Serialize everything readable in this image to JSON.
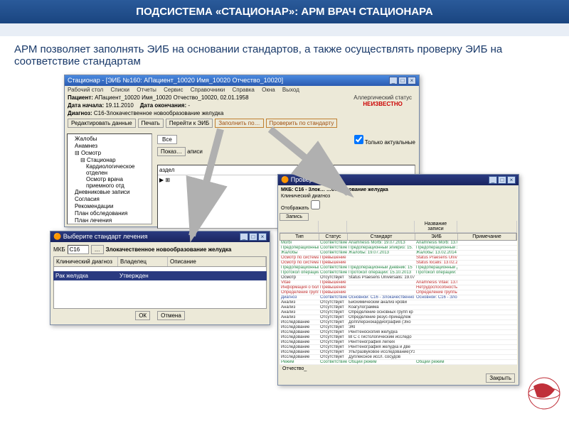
{
  "header": "ПОДСИСТЕМА «СТАЦИОНАР»: АРМ ВРАЧ СТАЦИОНАРА",
  "intro": "АРМ позволяет заполнять ЭИБ на основании стандартов, а также осуществлять проверку ЭИБ на соответствие стандартам",
  "main": {
    "title": "Стационар - [ЭИБ №160: АПациент_10020 Имя_10020 Отчество_10020]",
    "menu": [
      "Рабочий стол",
      "Списки",
      "Отчеты",
      "Сервис",
      "Справочники",
      "Справка",
      "Окна",
      "Выход"
    ],
    "patient_lbl": "Пациент:",
    "patient": "АПациент_10020 Имя_10020 Отчество_10020, 02.01.1958",
    "date_start_lbl": "Дата начала:",
    "date_start": "19.11.2010",
    "date_end_lbl": "Дата окончания:",
    "date_end": "-",
    "diag_lbl": "Диагноз:",
    "diag": "C16-Злокачественное новообразование желудка",
    "allergy_lbl": "Аллергический статус",
    "allergy_val": "НЕИЗВЕСТНО",
    "buttons": {
      "edit": "Редактировать данные",
      "print": "Печать",
      "goto": "Перейти к ЭИБ",
      "fill": "Заполнить по…",
      "check": "Проверить по стандарту"
    },
    "tab_all": "Все",
    "only_actual": "Только актуальные",
    "show_btn": "Показ…",
    "list_lbl": "аписи",
    "razdel": "аздел",
    "tree": [
      "Жалобы",
      "Анамнез",
      "Осмотр",
      "Стационар",
      "Кардиологическое отделен",
      "Осмотр врача приемного отд",
      "Дневниковые записи",
      "Согласия",
      "Рекомендации",
      "План обследования",
      "План лечения"
    ]
  },
  "dlg1": {
    "title": "Выберите стандарт лечения",
    "mkb_lbl": "МКБ",
    "mkb_val": "C16",
    "diag": "Злокачественное новообразование желудка",
    "cols": [
      "Клинический диагноз",
      "Владелец",
      "Описание"
    ],
    "row": [
      "Рак желудка",
      "Утвержден",
      ""
    ],
    "ok": "ОК",
    "cancel": "Отмена"
  },
  "win2": {
    "title": "Проверка по…",
    "mkb_line": "МКБ: C16 - Злок…                  …ообразование желудка",
    "diag2": "Клинический диагноз",
    "filter": "Отображать",
    "tab1": "Запись",
    "tab2": "Название записи",
    "cols": [
      "Тип",
      "Статус",
      "Стандарт",
      "ЭИБ",
      "Примечание"
    ],
    "rows": [
      {
        "c": "c-green",
        "v": [
          "Morbi",
          "Соответствие",
          "Anamnesis Morbi: 19.07.2013",
          "Anamnesis Morb: 13.02.2014",
          ""
        ]
      },
      {
        "c": "c-green",
        "v": [
          "Предоперационный д",
          "Соответствие",
          "Предоперационный эпикриз: 15.",
          "Предоперационный эпикриз: 13.02",
          ""
        ]
      },
      {
        "c": "c-green",
        "v": [
          "Жалобы",
          "Соответствие",
          "Жалобы: 19.07.2013",
          "Жалобы: 13.02.2014",
          ""
        ]
      },
      {
        "c": "c-red",
        "v": [
          "Осмотр по системам о",
          "Превышение",
          "",
          "Status Praesens Universalis: 13.02.201",
          ""
        ]
      },
      {
        "c": "c-red",
        "v": [
          "Осмотр по системам о",
          "Превышение",
          "",
          "Status localis: 13.02.2014",
          ""
        ]
      },
      {
        "c": "c-green",
        "v": [
          "Предоперационный д",
          "Соответствие",
          "Предоперационный дневник: 15",
          "Предоперационный дневник: 18.02.",
          ""
        ]
      },
      {
        "c": "c-green",
        "v": [
          "Протокол операции",
          "Соответствие",
          "Протокол операции: 15.10.2013",
          "Протокол операции: 13.02.2014",
          ""
        ]
      },
      {
        "c": "c-black",
        "v": [
          "Осмотр",
          "Отсутствует",
          "Status Praesens Universalis: 19.07",
          "",
          ""
        ]
      },
      {
        "c": "c-red",
        "v": [
          "Vitae",
          "Превышение",
          "",
          "Anamnesis Vitae: 13.02.2014",
          ""
        ]
      },
      {
        "c": "c-red",
        "v": [
          "Информация о больни",
          "Превышение",
          "",
          "Нетрудоспособность: 13.02.2014",
          ""
        ]
      },
      {
        "c": "c-red",
        "v": [
          "Определение группы",
          "Превышение",
          "",
          "Определение группы крови: 13.02.2014",
          ""
        ]
      },
      {
        "c": "c-blue",
        "v": [
          "Диагноз",
          "Соответствие",
          "Основной: C16 - Злокачественно",
          "Основной: C16 - Злокачественное но",
          ""
        ]
      },
      {
        "c": "c-black",
        "v": [
          "Анализ",
          "Отсутствует",
          "Биохимический анализ крови",
          "",
          ""
        ]
      },
      {
        "c": "c-black",
        "v": [
          "Анализ",
          "Отсутствует",
          "Коагулограмма",
          "",
          ""
        ]
      },
      {
        "c": "c-black",
        "v": [
          "Анализ",
          "Отсутствует",
          "Определение основных групп кр",
          "",
          ""
        ]
      },
      {
        "c": "c-black",
        "v": [
          "Анализ",
          "Отсутствует",
          "Определение резус-принадлеж",
          "",
          ""
        ]
      },
      {
        "c": "c-black",
        "v": [
          "Исследование",
          "Отсутствует",
          "Допплерэхокардиография (Эхо",
          "",
          ""
        ]
      },
      {
        "c": "c-black",
        "v": [
          "Исследование",
          "Отсутствует",
          "ЭКГ",
          "",
          ""
        ]
      },
      {
        "c": "c-black",
        "v": [
          "Исследование",
          "Отсутствует",
          "Рентгеноскопия желудка",
          "",
          ""
        ]
      },
      {
        "c": "c-black",
        "v": [
          "Исследование",
          "Отсутствует",
          "ВГС с гистологическим исследо",
          "",
          ""
        ]
      },
      {
        "c": "c-black",
        "v": [
          "Исследование",
          "Отсутствует",
          "Рентгенография легких",
          "",
          ""
        ]
      },
      {
        "c": "c-black",
        "v": [
          "Исследование",
          "Отсутствует",
          "Рентгенография желудка и две",
          "",
          ""
        ]
      },
      {
        "c": "c-black",
        "v": [
          "Исследование",
          "Отсутствует",
          "Ультразвуковое исследование(УЗИ органо",
          "",
          ""
        ]
      },
      {
        "c": "c-black",
        "v": [
          "Исследование",
          "Отсутствует",
          "Дуплексное иссл. сосудов",
          "",
          ""
        ]
      },
      {
        "c": "c-green",
        "v": [
          "Режим",
          "Соответствие",
          "Общий режим",
          "Общий режим",
          ""
        ]
      }
    ],
    "otch": "Отчество_",
    "close": "Закрыть"
  }
}
